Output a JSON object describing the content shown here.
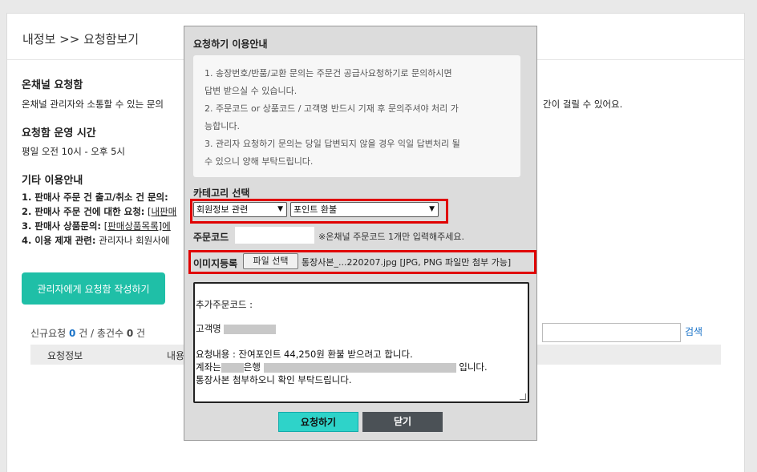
{
  "page": {
    "title": "내정보 >> 요청함보기",
    "channel_title": "온채널 요청함",
    "channel_desc_left": "온채널 관리자와 소통할 수 있는 문의",
    "channel_desc_right": "간이 걸릴 수 있어요.",
    "hours_title": "요청함 운영 시간",
    "hours_text": "평일 오전 10시 - 오후 5시",
    "other_title": "기타 이용안내",
    "other_items": [
      {
        "prefix": "1. 판매사 주문 건 출고/취소 건 문의:",
        "link": ""
      },
      {
        "prefix": "2. 판매사 주문 건에 대한 요청:",
        "link": "[내판매"
      },
      {
        "prefix": "3. 판매사 상품문의:",
        "link": "[판매상품목록]에"
      },
      {
        "prefix": "4. 이용 제재 관련:",
        "rest": "관리자나 회원사에"
      }
    ],
    "write_button": "관리자에게 요청함 작성하기",
    "new_label": "신규요청",
    "new_count": "0",
    "unit1": "건 / 총건수",
    "total_count": "0",
    "unit2": "건",
    "search_link": "검색",
    "th_info": "요청정보",
    "th_content": "내용"
  },
  "modal": {
    "title": "요청하기 이용안내",
    "notices": [
      "1. 송장번호/반품/교환 문의는 주문건 공급사요청하기로 문의하시면",
      "답변 받으실 수 있습니다.",
      "2. 주문코드 or 상품코드 / 고객명 반드시 기재 후 문의주셔야 처리 가",
      "능합니다.",
      "3. 관리자 요청하기 문의는 당일 답변되지 않을 경우 익일 답변처리 될",
      "수 있으니 양해 부탁드립니다."
    ],
    "category_label": "카테고리 선택",
    "category_value": "회원정보 관련",
    "subcategory_value": "포인트 환불",
    "order_code_label": "주문코드",
    "order_code_value": "",
    "order_code_hint": "※온채널 주문코드 1개만 입력해주세요.",
    "image_label": "이미지등록",
    "file_button": "파일 선택",
    "file_name": "통장사본_...220207.jpg  [JPG, PNG 파일만 첨부 가능]",
    "ta_line1": "추가주문코드 :",
    "ta_line2": "고객명",
    "ta_line3": "요청내용 : 잔여포인트 44,250원 환불 받으려고 합니다.",
    "ta_line4a": "계좌는",
    "ta_line4b": "은행",
    "ta_line4c": "입니다.",
    "ta_line5": "통장사본 첨부하오니 확인 부탁드립니다.",
    "submit_button": "요청하기",
    "close_button": "닫기"
  }
}
